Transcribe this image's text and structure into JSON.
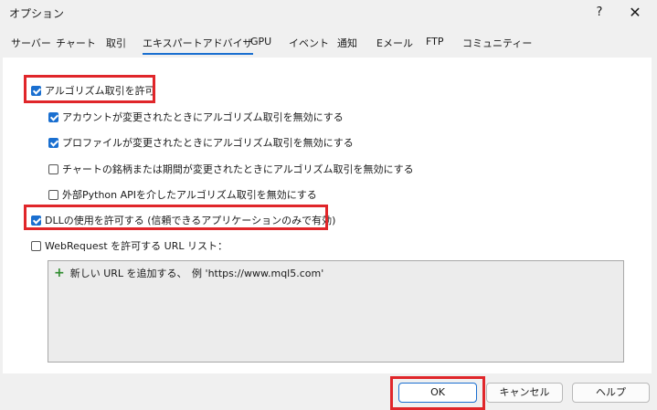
{
  "window": {
    "title": "オプション",
    "help_icon": "?",
    "close_icon": "✕"
  },
  "tabs": [
    {
      "label": "サーバー",
      "active": false
    },
    {
      "label": "チャート",
      "active": false
    },
    {
      "label": "取引",
      "active": false
    },
    {
      "label": "エキスパートアドバイザ",
      "active": true
    },
    {
      "label": "GPU",
      "active": false
    },
    {
      "label": "イベント",
      "active": false
    },
    {
      "label": "通知",
      "active": false
    },
    {
      "label": "Eメール",
      "active": false
    },
    {
      "label": "FTP",
      "active": false
    },
    {
      "label": "コミュニティー",
      "active": false
    }
  ],
  "options": {
    "allow_algo": {
      "label": "アルゴリズム取引を許可",
      "checked": true
    },
    "disable_on_account": {
      "label": "アカウントが変更されたときにアルゴリズム取引を無効にする",
      "checked": true
    },
    "disable_on_profile": {
      "label": "プロファイルが変更されたときにアルゴリズム取引を無効にする",
      "checked": true
    },
    "disable_on_chart": {
      "label": "チャートの銘柄または期間が変更されたときにアルゴリズム取引を無効にする",
      "checked": false
    },
    "disable_python": {
      "label": "外部Python APIを介したアルゴリズム取引を無効にする",
      "checked": false
    },
    "allow_dll": {
      "label": "DLLの使用を許可する (信頼できるアプリケーションのみで有効)",
      "checked": true
    },
    "allow_webrequest": {
      "label": "WebRequest を許可する URL リスト：",
      "checked": false
    }
  },
  "url_list": {
    "add_label": "新しい URL を追加する、　例 'https://www.mql5.com'",
    "add_icon": "+"
  },
  "buttons": {
    "ok": "OK",
    "cancel": "キャンセル",
    "help": "ヘルプ"
  },
  "colors": {
    "accent": "#1a6fd0",
    "highlight": "#e0262a",
    "add_icon": "#2e8b2e"
  }
}
